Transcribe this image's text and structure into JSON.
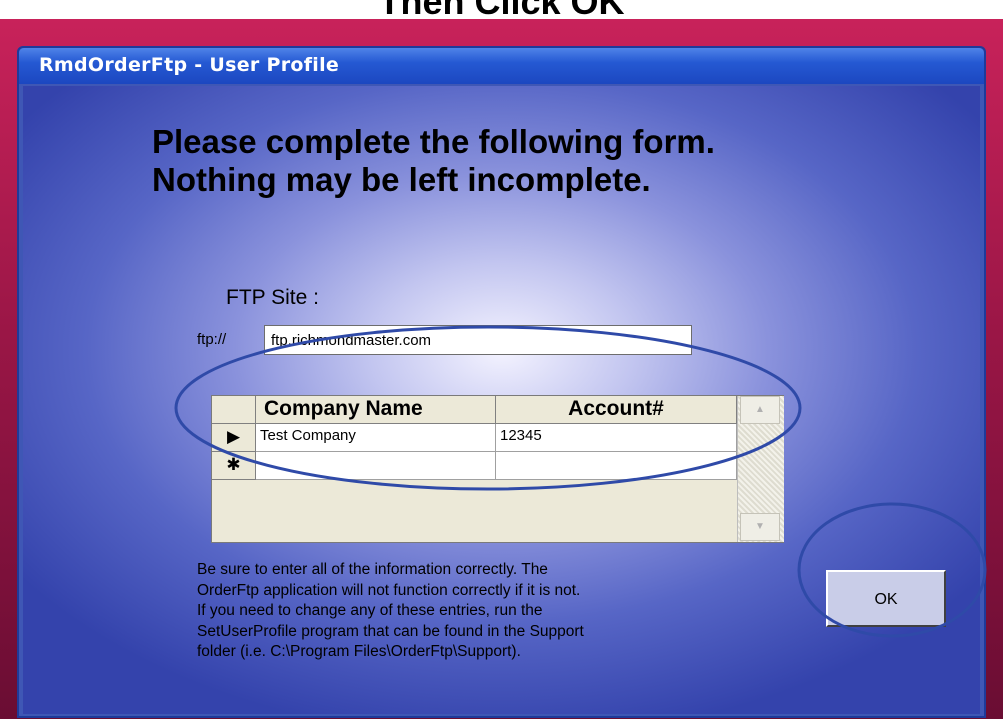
{
  "banner": {
    "text": "Then Click OK"
  },
  "window": {
    "title": "RmdOrderFtp - User Profile"
  },
  "form": {
    "headline_line1": "Please complete the following form.",
    "headline_line2": "Nothing may be left incomplete.",
    "ftp_label": "FTP Site :",
    "ftp_prefix": "ftp://",
    "ftp_value": "ftp.richmondmaster.com"
  },
  "grid": {
    "columns": [
      "Company Name",
      "Account#"
    ],
    "rows": [
      {
        "selector": "▶",
        "company": "Test Company",
        "account": "12345"
      },
      {
        "selector": "✱",
        "company": "",
        "account": ""
      }
    ],
    "scroll_up": "▲",
    "scroll_down": "▼"
  },
  "help": {
    "lines": [
      "Be sure to enter all of the information correctly. The",
      "OrderFtp application will not function correctly if it is not.",
      "If you need to change any of these entries, run the",
      "SetUserProfile program that can be found in the Support",
      "folder (i.e. C:\\Program Files\\OrderFtp\\Support)."
    ]
  },
  "buttons": {
    "ok_label": "OK"
  },
  "colors": {
    "frame": "#9a1646",
    "titlebar": "#2559d3",
    "annotation": "#2f4aa8",
    "button_face": "#c9cde8"
  }
}
